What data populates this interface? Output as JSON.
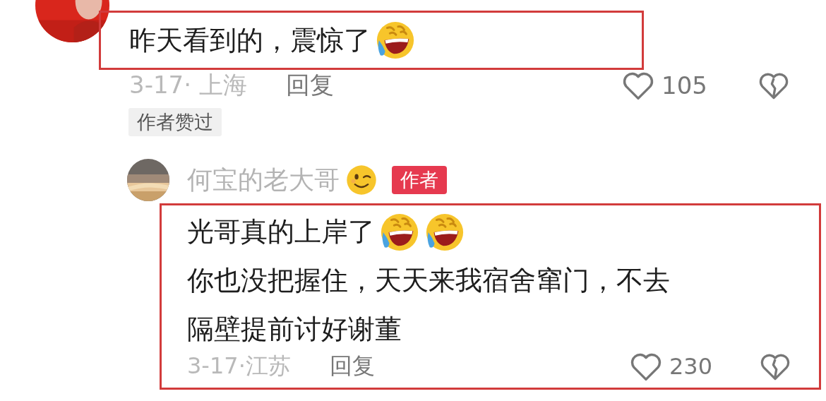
{
  "comment": {
    "highlighted": true,
    "lines": [
      {
        "text": "昨天看到的，震惊了",
        "emojis": [
          {
            "kind": "laugh_cry"
          }
        ]
      }
    ],
    "date_location": "3-17· 上海",
    "reply_label": "回复",
    "likes": "105",
    "liked": false,
    "author_liked_tag": "作者赞过",
    "reply": {
      "author": "何宝的老大哥",
      "author_emojis": [
        {
          "kind": "wink"
        }
      ],
      "author_badge": "作者",
      "highlighted": true,
      "lines": [
        {
          "text": "光哥真的上岸了",
          "emojis": [
            {
              "kind": "laugh_cry"
            },
            {
              "kind": "laugh_cry"
            }
          ]
        },
        {
          "text": "你也没把握住，天天来我宿舍窜门，不去"
        },
        {
          "text": "隔壁提前讨好谢董"
        }
      ],
      "date_location": "3-17·江苏",
      "reply_label": "回复",
      "likes": "230",
      "liked": false
    }
  }
}
